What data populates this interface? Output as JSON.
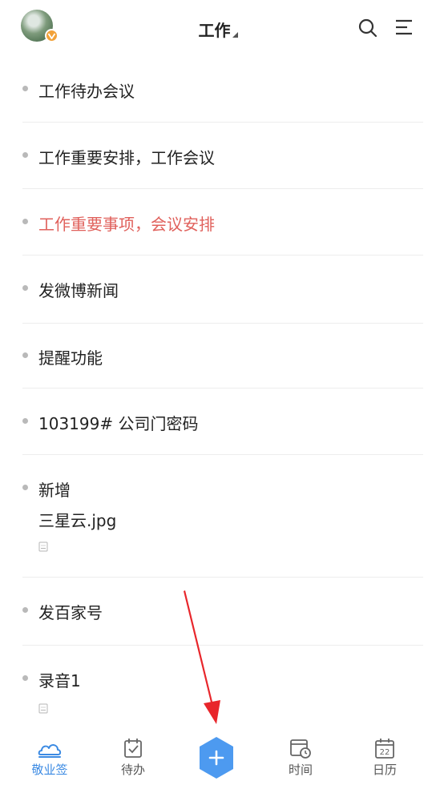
{
  "header": {
    "title": "工作"
  },
  "items": [
    {
      "text": "工作待办会议",
      "highlight": false
    },
    {
      "text": "工作重要安排，工作会议",
      "highlight": false
    },
    {
      "text": "工作重要事项，会议安排",
      "highlight": true
    },
    {
      "text": "发微博新闻",
      "highlight": false
    },
    {
      "text": "提醒功能",
      "highlight": false
    },
    {
      "text": "103199# 公司门密码",
      "highlight": false
    },
    {
      "text": "新增",
      "line2": "三星云.jpg",
      "attachment": true,
      "highlight": false
    },
    {
      "text": "发百家号",
      "highlight": false
    },
    {
      "text": "录音1",
      "attachment": true,
      "highlight": false
    }
  ],
  "nav": {
    "items": [
      {
        "label": "敬业签",
        "active": true
      },
      {
        "label": "待办",
        "active": false
      },
      {
        "label": "时间",
        "active": false
      },
      {
        "label": "日历",
        "active": false
      }
    ],
    "calendar_day": "22"
  },
  "colors": {
    "accent": "#3b8ae3",
    "highlight_text": "#e0615c",
    "arrow": "#e8262b"
  }
}
